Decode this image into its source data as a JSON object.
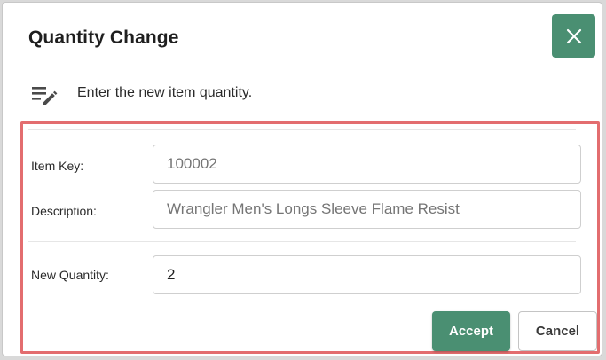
{
  "dialog": {
    "title": "Quantity Change",
    "close_icon": "close-icon",
    "instruction_icon": "edit-list-icon",
    "instruction": "Enter the new item quantity."
  },
  "form": {
    "item_key": {
      "label": "Item Key:",
      "placeholder": "100002",
      "value": ""
    },
    "description": {
      "label": "Description:",
      "placeholder": "Wrangler Men's Longs Sleeve Flame Resist",
      "value": ""
    },
    "new_quantity": {
      "label": "New Quantity:",
      "value": "2"
    }
  },
  "actions": {
    "accept_label": "Accept",
    "cancel_label": "Cancel"
  },
  "colors": {
    "accent": "#4a8f72",
    "highlight_border": "#e36d6f"
  }
}
